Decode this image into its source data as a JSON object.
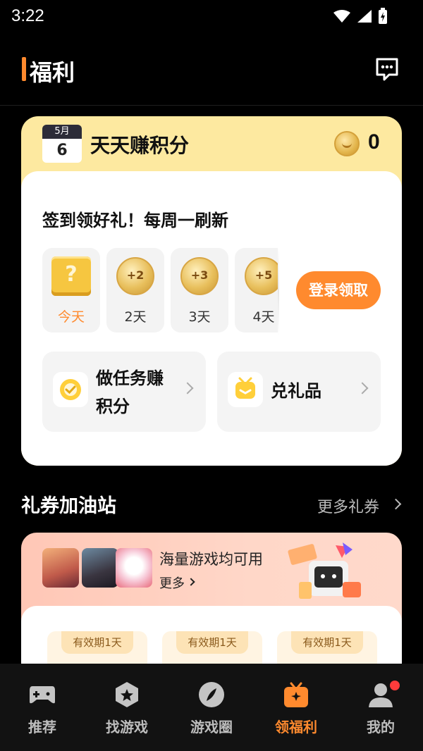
{
  "status": {
    "time": "3:22"
  },
  "header": {
    "title": "福利",
    "message_icon": "message-icon"
  },
  "points": {
    "calendar_month": "5月",
    "calendar_day": "6",
    "title": "天天赚积分",
    "count": "0",
    "subtitle": "签到领好礼！每周一刷新",
    "days": [
      {
        "reward": "",
        "label": "今天"
      },
      {
        "reward": "+2",
        "label": "2天"
      },
      {
        "reward": "+3",
        "label": "3天"
      },
      {
        "reward": "+5",
        "label": "4天"
      }
    ],
    "claim_label": "登录领取",
    "tasks": [
      {
        "label_line1": "做任务赚",
        "label_line2": "积分",
        "icon": "check-circle-icon"
      },
      {
        "label": "兑礼品",
        "icon": "gift-icon"
      }
    ]
  },
  "coupons": {
    "title": "礼券加油站",
    "more_label": "更多礼券",
    "banner_text": "海量游戏均可用",
    "banner_more": "更多",
    "voucher_tag": "有效期1天"
  },
  "tabbar": {
    "items": [
      {
        "label": "推荐",
        "icon": "gamepad-icon"
      },
      {
        "label": "找游戏",
        "icon": "hexagon-star-icon"
      },
      {
        "label": "游戏圈",
        "icon": "compass-icon"
      },
      {
        "label": "领福利",
        "icon": "gift-box-icon"
      },
      {
        "label": "我的",
        "icon": "person-icon"
      }
    ],
    "active_index": 3
  },
  "colors": {
    "accent": "#ff8a2e",
    "card_yellow": "#fde9a0",
    "notification": "#ff3b3b"
  }
}
